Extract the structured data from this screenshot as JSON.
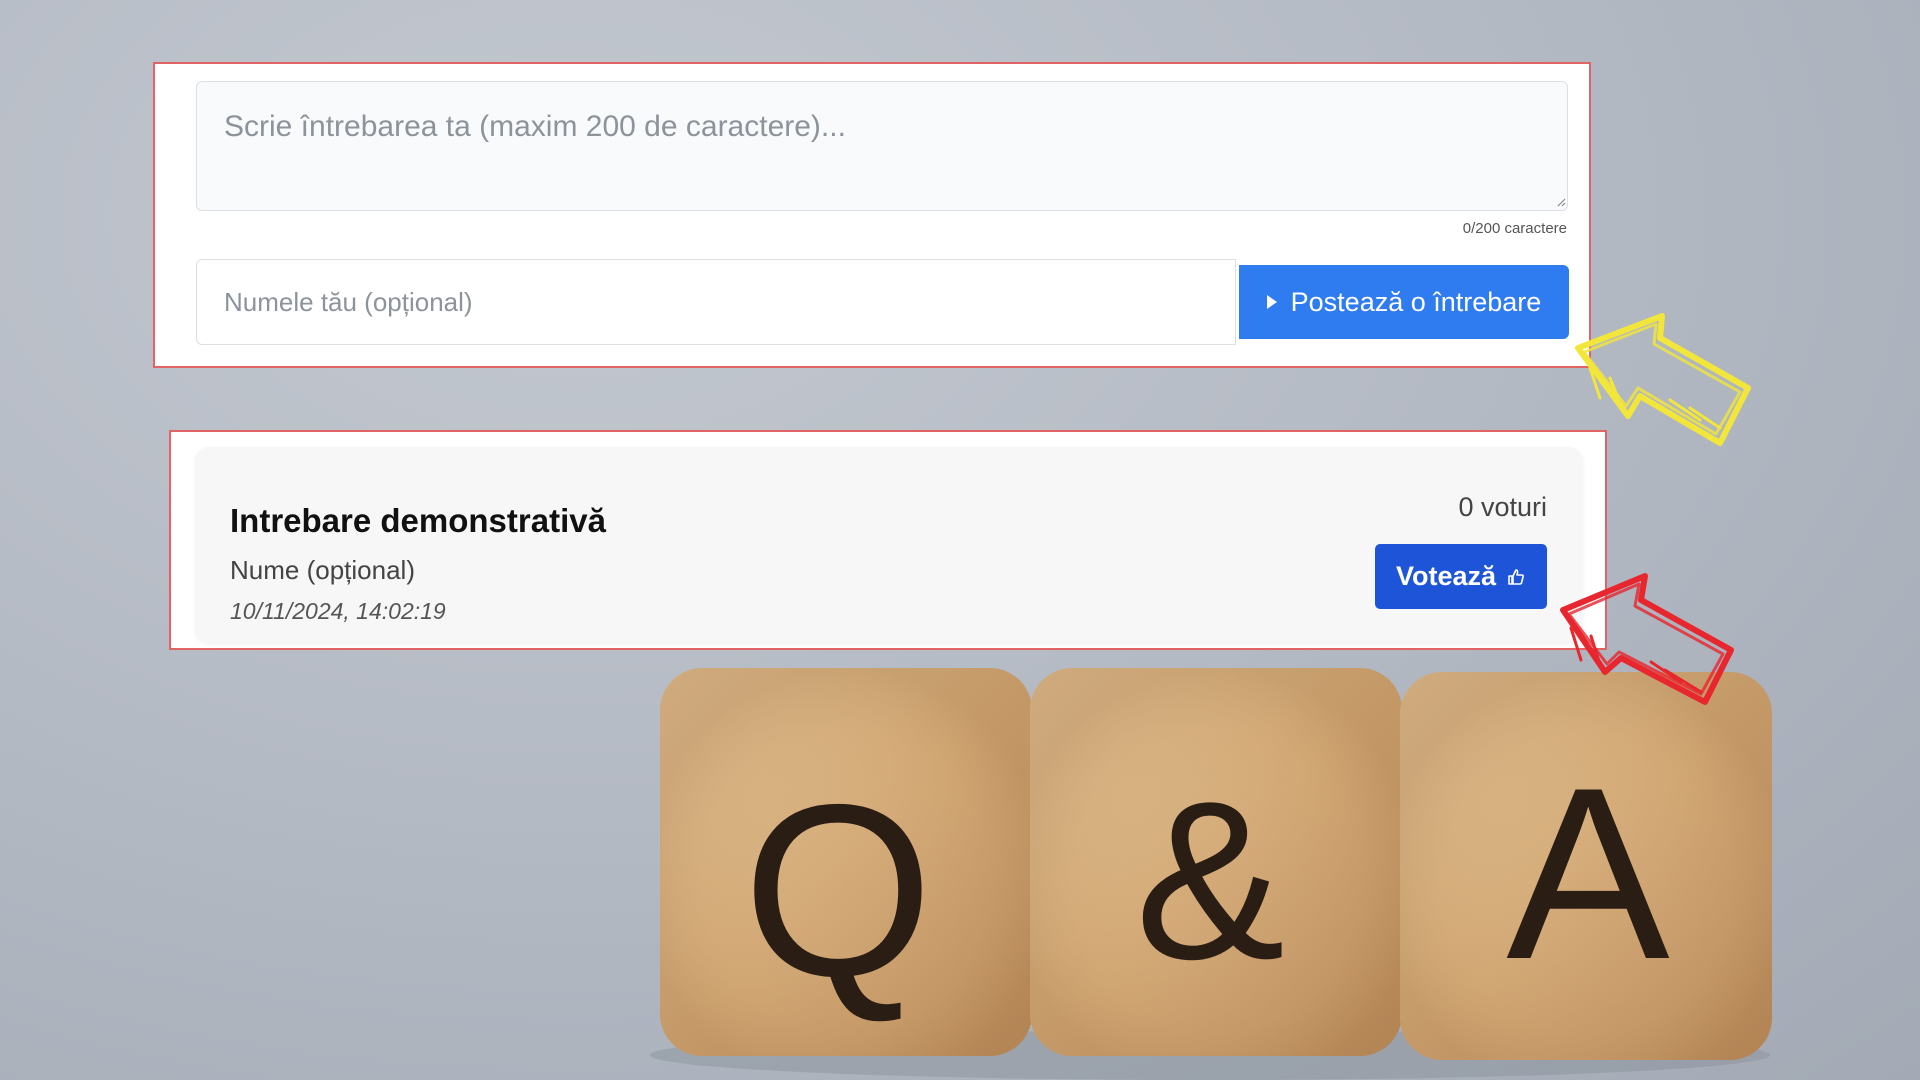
{
  "form": {
    "question_placeholder": "Scrie întrebarea ta (maxim 200 de caractere)...",
    "question_value": "",
    "char_counter": "0/200 caractere",
    "name_placeholder": "Numele tău (opțional)",
    "name_value": "",
    "post_button_label": "Postează o întrebare"
  },
  "question": {
    "title": "Intrebare demonstrativă",
    "author": "Nume (opțional)",
    "date": "10/11/2024, 14:02:19",
    "votes_text": "0 voturi",
    "vote_button_label": "Votează"
  },
  "cubes": {
    "letters": [
      "Q",
      "&",
      "A"
    ]
  },
  "colors": {
    "post_button": "#2f7bf0",
    "vote_button": "#1e55d8",
    "frame_border": "#e06464",
    "yellow_arrow": "#f2e63a",
    "red_arrow": "#e8262e"
  },
  "icons": {
    "post_button_icon": "play-icon",
    "vote_button_icon": "thumbs-up-icon"
  }
}
